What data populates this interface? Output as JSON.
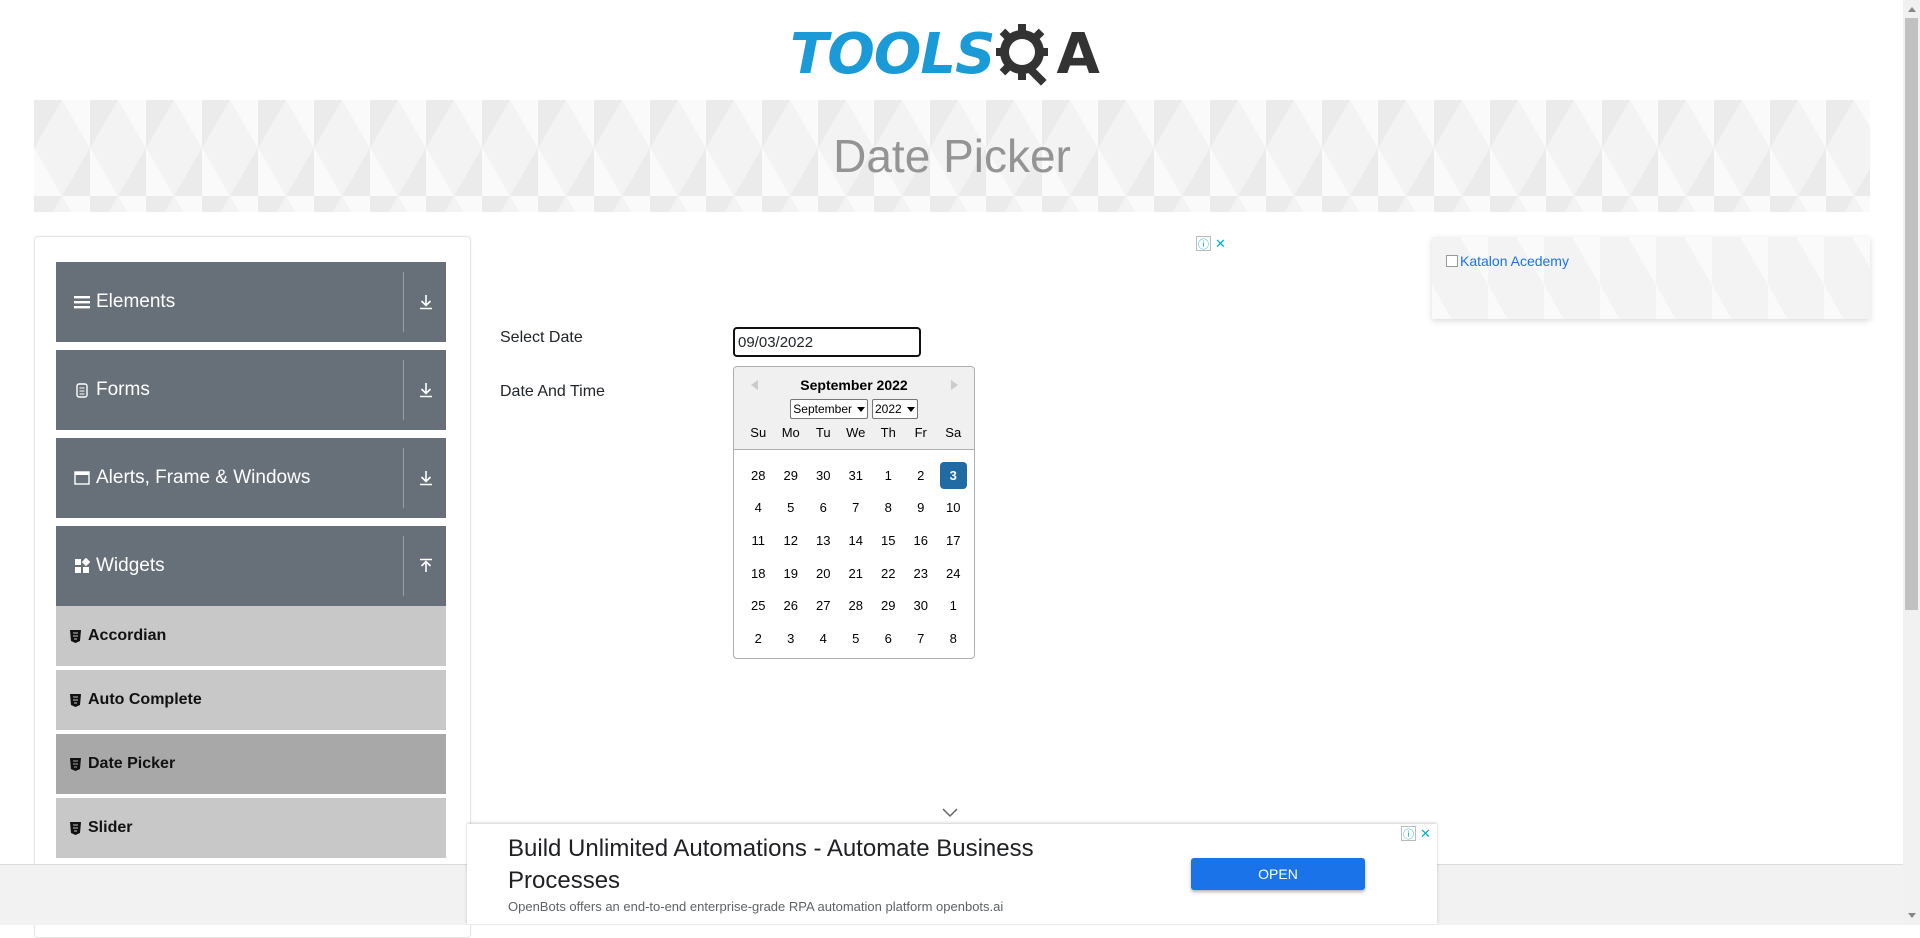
{
  "logo": {
    "text": "TOOLS",
    "suffix": "A"
  },
  "banner": {
    "title": "Date Picker"
  },
  "sidebar": {
    "groups": [
      {
        "label": "Elements",
        "icon": "hamburger-icon",
        "arrow": "download-arrow-icon"
      },
      {
        "label": "Forms",
        "icon": "document-icon",
        "arrow": "download-arrow-icon"
      },
      {
        "label": "Alerts, Frame & Windows",
        "icon": "window-icon",
        "arrow": "download-arrow-icon"
      },
      {
        "label": "Widgets",
        "icon": "widgets-icon",
        "arrow": "upload-arrow-icon"
      }
    ],
    "widget_items": [
      {
        "label": "Accordian"
      },
      {
        "label": "Auto Complete"
      },
      {
        "label": "Date Picker",
        "active": true
      },
      {
        "label": "Slider"
      }
    ]
  },
  "form": {
    "select_date_label": "Select Date",
    "date_time_label": "Date And Time",
    "date_value": "09/03/2022"
  },
  "calendar": {
    "month_title": "September 2022",
    "month_select": "September",
    "year_select": "2022",
    "day_names": [
      "Su",
      "Mo",
      "Tu",
      "We",
      "Th",
      "Fr",
      "Sa"
    ],
    "weeks": [
      [
        "28",
        "29",
        "30",
        "31",
        "1",
        "2",
        "3"
      ],
      [
        "4",
        "5",
        "6",
        "7",
        "8",
        "9",
        "10"
      ],
      [
        "11",
        "12",
        "13",
        "14",
        "15",
        "16",
        "17"
      ],
      [
        "18",
        "19",
        "20",
        "21",
        "22",
        "23",
        "24"
      ],
      [
        "25",
        "26",
        "27",
        "28",
        "29",
        "30",
        "1"
      ],
      [
        "2",
        "3",
        "4",
        "5",
        "6",
        "7",
        "8"
      ]
    ],
    "selected": "3"
  },
  "right_ad": {
    "alt_text": "Katalon Acedemy"
  },
  "bottom_ad": {
    "title": "Build Unlimited Automations - Automate Business Processes",
    "description": "OpenBots offers an end-to-end enterprise-grade RPA automation platform openbots.ai",
    "button": "OPEN"
  },
  "colors": {
    "sidebar_group": "#676f79",
    "sidebar_item": "#c8c8c8",
    "sidebar_active": "#a8a8a8",
    "selected_day": "#216ba5",
    "logo_blue": "#1a9ad6",
    "ad_button": "#1a73e8"
  }
}
